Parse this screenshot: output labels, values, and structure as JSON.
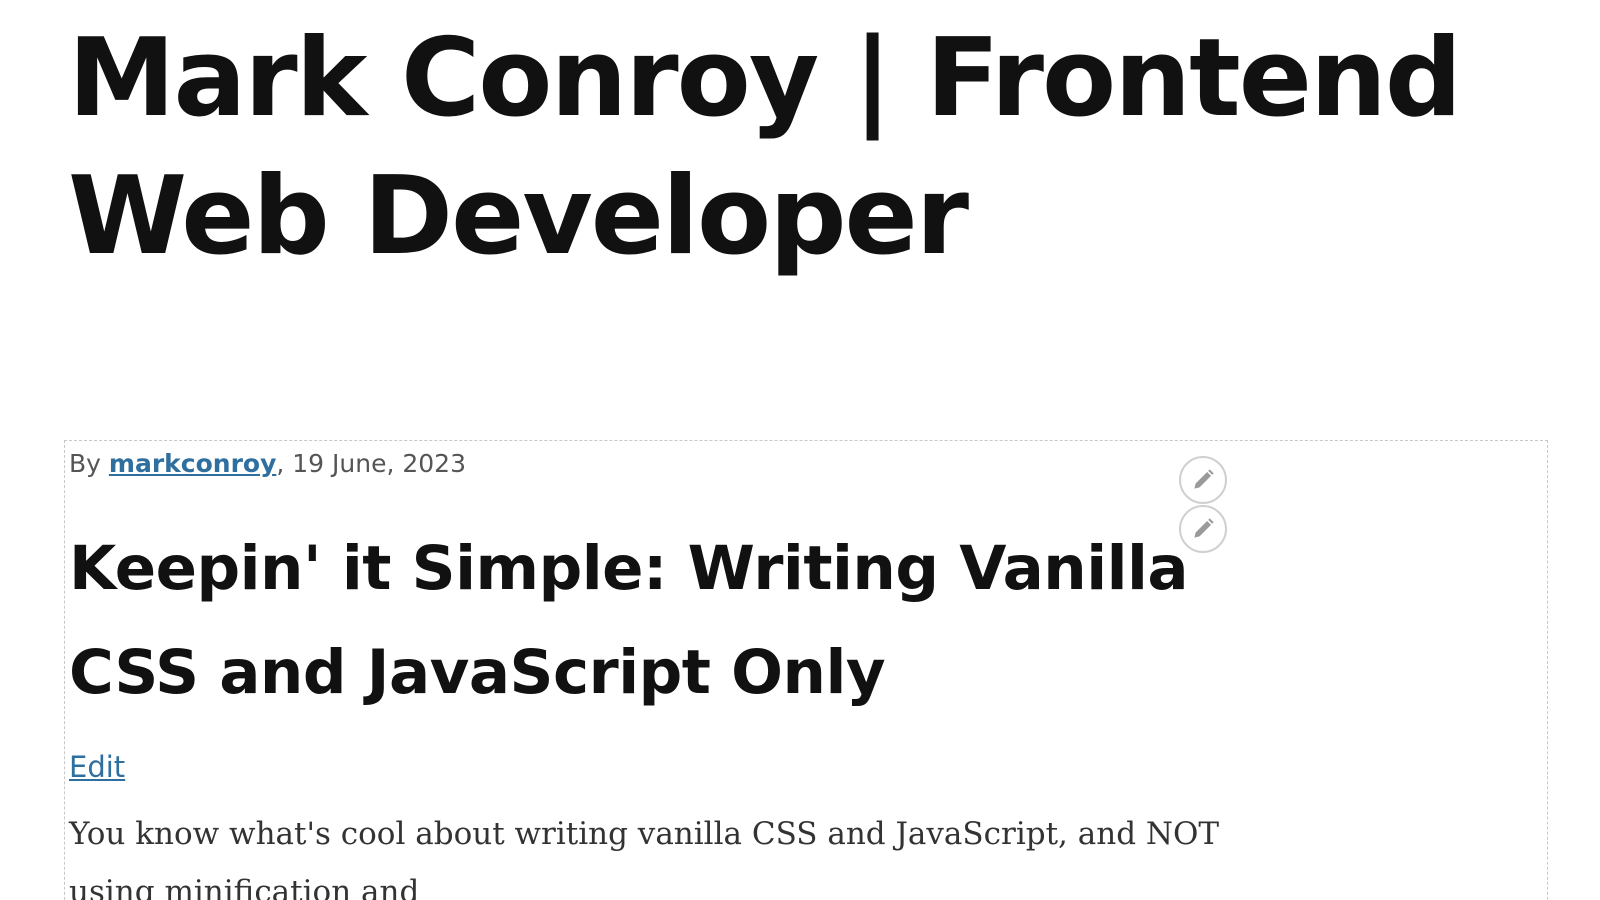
{
  "site": {
    "title": "Mark Conroy | Frontend Web Developer"
  },
  "article": {
    "byline_prefix": "By ",
    "author": "markconroy",
    "date": ", 19 June, 2023",
    "title": "Keepin' it Simple: Writing Vanilla CSS and JavaScript Only",
    "edit_label": "Edit",
    "body_text": "You know what's cool about writing vanilla CSS and JavaScript, and NOT using minification and"
  },
  "contextual_links": {
    "icon": "pencil-icon",
    "icon_color": "#9a9a9a"
  },
  "colors": {
    "link": "#2f6f9f",
    "meta_text": "#555555",
    "heading": "#111111",
    "body": "#333333",
    "dashed_border": "#c8c8c8"
  }
}
